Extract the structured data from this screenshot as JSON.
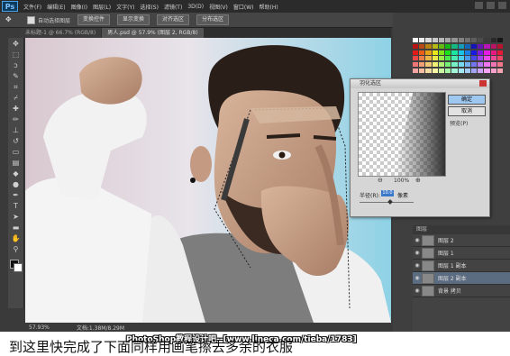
{
  "app": {
    "logo": "Ps",
    "menu": [
      "文件(F)",
      "编辑(E)",
      "图像(I)",
      "图层(L)",
      "文字(Y)",
      "选择(S)",
      "滤镜(T)",
      "3D(D)",
      "视图(V)",
      "窗口(W)",
      "帮助(H)"
    ]
  },
  "options_bar": {
    "tool_icon": "move-tool-icon",
    "auto_select_label": "自动选择图层",
    "buttons": [
      "变换控件",
      "显示变换",
      "对齐选区",
      "分布选区"
    ]
  },
  "tabs": [
    {
      "label": "未标题-1 @ 66.7% (RGB/8)",
      "active": false
    },
    {
      "label": "男人.psd @ 57.9% (图层 2, RGB/8)",
      "active": true
    }
  ],
  "status": {
    "zoom": "57.93%",
    "doc": "文档:1.38M/8.29M"
  },
  "layers_panel": {
    "header": "图层",
    "rows": [
      {
        "name": "图层 2",
        "active": false
      },
      {
        "name": "图层 1",
        "active": false
      },
      {
        "name": "图层 1 副本",
        "active": false
      },
      {
        "name": "图层 2 副本",
        "active": true
      },
      {
        "name": "背景 拷贝",
        "active": false
      }
    ]
  },
  "dialog": {
    "title": "羽化选区",
    "ok": "确定",
    "cancel": "取消",
    "preview": "预览(P)",
    "zoom": "100%",
    "field_label": "半径(R):",
    "field_value": "10.0",
    "unit": "像素"
  },
  "watermark": "PhotoShop教程设计吧--[www.lineca.com/tieba/1783]",
  "caption": "到这里快完成了下面同样用画笔擦去多余的衣服",
  "colors": {
    "accent": "#3a78c9",
    "panel_bg": "#3f3f3f",
    "canvas_bg": "#c4dfe6"
  }
}
